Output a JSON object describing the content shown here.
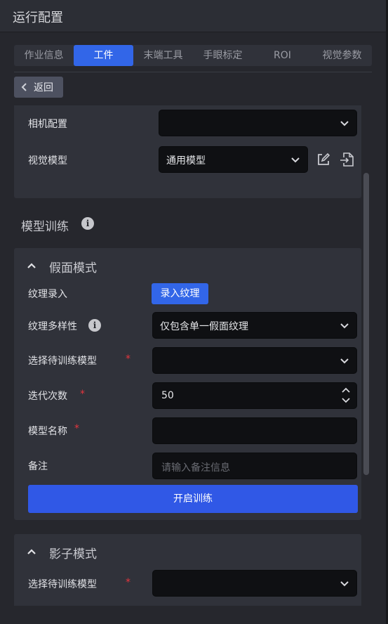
{
  "window": {
    "title": "运行配置"
  },
  "tabs": [
    {
      "label": "作业信息",
      "active": false
    },
    {
      "label": "工件",
      "active": true
    },
    {
      "label": "末端工具",
      "active": false
    },
    {
      "label": "手眼标定",
      "active": false
    },
    {
      "label": "ROI",
      "active": false
    },
    {
      "label": "视觉参数",
      "active": false
    }
  ],
  "back_button": {
    "label": "返回",
    "icon": "chevron-left-icon"
  },
  "camera_config": {
    "label": "相机配置",
    "value": ""
  },
  "vision_model": {
    "label": "视觉模型",
    "value": "通用模型",
    "edit_icon": "edit-icon",
    "import_icon": "import-icon"
  },
  "model_training": {
    "title": "模型训练",
    "info_icon": "info-icon"
  },
  "mask_mode": {
    "title": "假面模式",
    "texture_entry": {
      "label": "纹理录入",
      "button": "录入纹理"
    },
    "texture_diversity": {
      "label": "纹理多样性",
      "value": "仅包含单一假面纹理"
    },
    "select_model": {
      "label": "选择待训练模型",
      "required": "*",
      "value": ""
    },
    "iterations": {
      "label": "迭代次数",
      "required": "*",
      "value": "50"
    },
    "model_name": {
      "label": "模型名称",
      "required": "*",
      "value": ""
    },
    "remark": {
      "label": "备注",
      "placeholder": "请输入备注信息"
    },
    "start_button": "开启训练"
  },
  "shadow_mode": {
    "title": "影子模式",
    "select_model": {
      "label": "选择待训练模型",
      "required": "*",
      "value": ""
    }
  },
  "colors": {
    "accent": "#3266e8",
    "required": "#e5363e",
    "panel": "#30323a",
    "field": "#0f1013"
  }
}
